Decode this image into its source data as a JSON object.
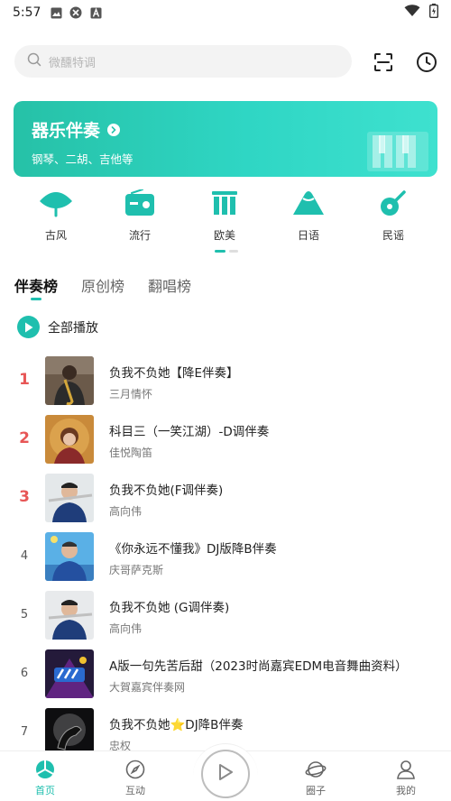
{
  "status": {
    "time": "5:57"
  },
  "search": {
    "placeholder": "微醺特调"
  },
  "banner": {
    "title": "器乐伴奏",
    "subtitle": "钢琴、二胡、吉他等"
  },
  "categories": [
    {
      "label": "古风",
      "icon": "fan-icon"
    },
    {
      "label": "流行",
      "icon": "radio-icon"
    },
    {
      "label": "欧美",
      "icon": "building-icon"
    },
    {
      "label": "日语",
      "icon": "mountain-icon"
    },
    {
      "label": "民谣",
      "icon": "guitar-icon"
    }
  ],
  "tabs": [
    {
      "label": "伴奏榜",
      "active": true
    },
    {
      "label": "原创榜",
      "active": false
    },
    {
      "label": "翻唱榜",
      "active": false
    }
  ],
  "play_all": {
    "label": "全部播放"
  },
  "songs": [
    {
      "rank": "1",
      "title": "负我不负她【降E伴奏】",
      "artist": "三月情怀"
    },
    {
      "rank": "2",
      "title": "科目三（一笑江湖）-D调伴奏",
      "artist": "佳悦陶笛"
    },
    {
      "rank": "3",
      "title": "负我不负她(F调伴奏)",
      "artist": "高向伟"
    },
    {
      "rank": "4",
      "title": "《你永远不懂我》DJ版降B伴奏",
      "artist": "庆哥萨克斯"
    },
    {
      "rank": "5",
      "title": "负我不负她 (G调伴奏)",
      "artist": "高向伟"
    },
    {
      "rank": "6",
      "title": "A版一句先苦后甜（2023时尚嘉宾EDM电音舞曲资料）",
      "artist": "大賀嘉宾伴奏网"
    },
    {
      "rank": "7",
      "title": "负我不负她⭐DJ降B伴奏",
      "artist": "忠权"
    }
  ],
  "nav": [
    {
      "label": "首页",
      "active": true
    },
    {
      "label": "互动",
      "active": false
    },
    {
      "label": "圈子",
      "active": false
    },
    {
      "label": "我的",
      "active": false
    }
  ],
  "colors": {
    "accent": "#1fbfae",
    "rank_top": "#e75656",
    "banner_start": "#26c1a7",
    "banner_end": "#3ee1cf"
  }
}
